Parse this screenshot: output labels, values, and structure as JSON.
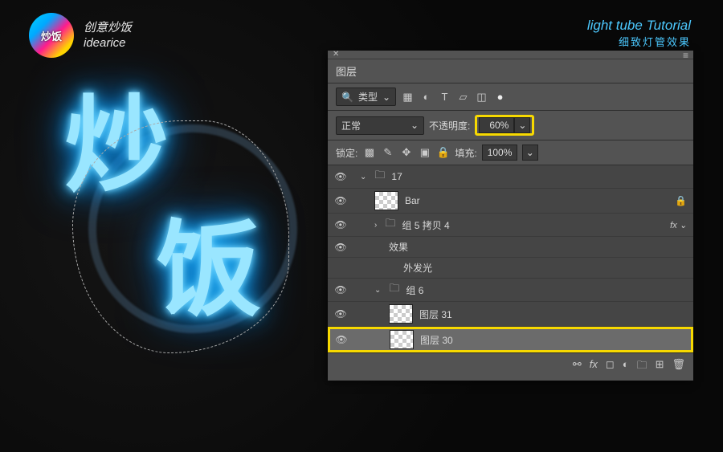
{
  "brand": {
    "logo_text": "炒饭",
    "cn": "创意炒饭",
    "en": "idearice"
  },
  "tutorial": {
    "en": "light tube Tutorial",
    "cn": "细致灯管效果"
  },
  "neon": {
    "char1": "炒",
    "char2": "饭"
  },
  "panel": {
    "title": "图层",
    "filter": {
      "label": "类型"
    },
    "blend": {
      "mode": "正常",
      "opacity_label": "不透明度:",
      "opacity_value": "60%"
    },
    "lock": {
      "label": "锁定:",
      "fill_label": "填充:",
      "fill_value": "100%"
    },
    "layers": [
      {
        "type": "group",
        "name": "17",
        "indent": 0,
        "open": true
      },
      {
        "type": "layer",
        "name": "Bar",
        "indent": 1,
        "locked": true,
        "thumb": "checker"
      },
      {
        "type": "group",
        "name": "组 5 拷贝 4",
        "indent": 1,
        "collapsed": true,
        "fx": true
      },
      {
        "type": "fxlabel",
        "name": "效果",
        "indent": 2
      },
      {
        "type": "fxitem",
        "name": "外发光",
        "indent": 3
      },
      {
        "type": "group",
        "name": "组 6",
        "indent": 1,
        "open": true
      },
      {
        "type": "layer",
        "name": "图层 31",
        "indent": 2,
        "thumb": "checker"
      },
      {
        "type": "layer",
        "name": "图层 30",
        "indent": 2,
        "thumb": "checker",
        "selected": true
      }
    ]
  }
}
